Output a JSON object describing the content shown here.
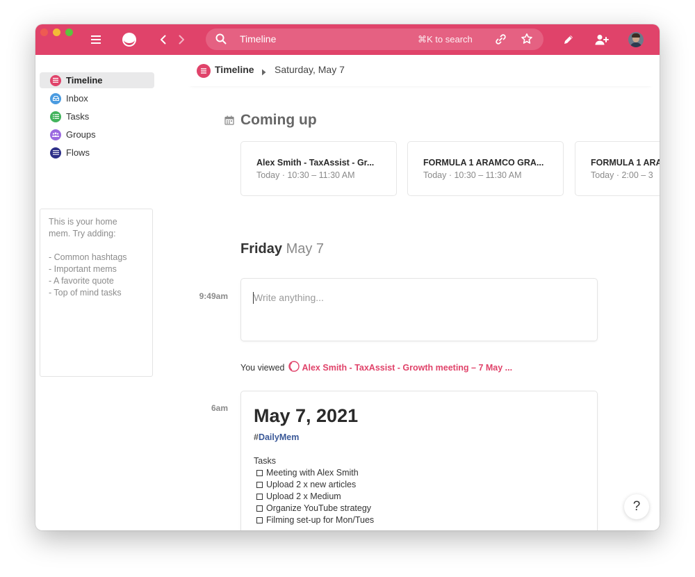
{
  "topbar": {
    "color": "#e0436a",
    "menu_icon": "hamburger-icon",
    "logo_icon": "mem-logo-icon",
    "back_icon": "chevron-left-icon",
    "forward_icon": "chevron-right-icon",
    "search": {
      "value": "Timeline",
      "hint": "⌘K to search",
      "icon": "search-icon"
    },
    "link_icon": "link-icon",
    "star_icon": "star-icon",
    "compose_icon": "pencil-icon",
    "invite_icon": "add-user-icon",
    "avatar_icon": "user-avatar"
  },
  "sidebar": {
    "items": [
      {
        "label": "Timeline",
        "color": "#e0436a",
        "icon": "list-icon",
        "active": true
      },
      {
        "label": "Inbox",
        "color": "#4a9be0",
        "icon": "inbox-icon",
        "active": false
      },
      {
        "label": "Tasks",
        "color": "#42b35c",
        "icon": "checklist-icon",
        "active": false
      },
      {
        "label": "Groups",
        "color": "#9b6ae0",
        "icon": "people-icon",
        "active": false
      },
      {
        "label": "Flows",
        "color": "#2d2f88",
        "icon": "flows-icon",
        "active": false
      }
    ],
    "home_mem": [
      "This is your home",
      "mem. Try adding:",
      "",
      "- Common hashtags",
      "- Important mems",
      "- A favorite quote",
      "- Top of mind tasks"
    ]
  },
  "header": {
    "title": "Timeline",
    "date": "Saturday, May 7"
  },
  "coming_up": {
    "title": "Coming up",
    "icon": "calendar-icon",
    "cards": [
      {
        "title": "Alex Smith - TaxAssist - Gr...",
        "day": "Today",
        "time": "10:30 – 11:30 AM"
      },
      {
        "title": "FORMULA 1 ARAMCO GRA...",
        "day": "Today",
        "time": "10:30 – 11:30 AM"
      },
      {
        "title": "FORMULA 1 ARA",
        "day": "Today",
        "time": "2:00 – 3"
      }
    ]
  },
  "day": {
    "weekday": "Friday",
    "date": "May 7"
  },
  "composer": {
    "time": "9:49am",
    "placeholder": "Write anything..."
  },
  "viewed": {
    "prefix": "You viewed",
    "link": "Alex Smith - TaxAssist - Growth meeting – 7 May ..."
  },
  "mem": {
    "time": "6am",
    "title": "May 7, 2021",
    "hash": "#",
    "tag": "DailyMem",
    "subtitle": "Tasks",
    "tasks": [
      "Meeting with Alex Smith",
      "Upload 2 x new articles",
      "Upload 2 x Medium",
      "Organize YouTube strategy",
      "Filming set-up for Mon/Tues"
    ]
  },
  "help": {
    "label": "?"
  }
}
